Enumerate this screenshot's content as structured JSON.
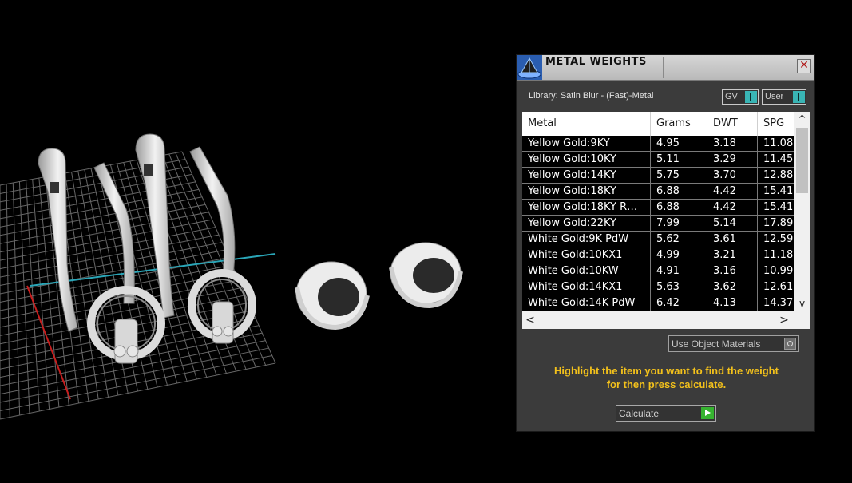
{
  "panel": {
    "title": "METAL WEIGHTS",
    "close_glyph": "✕",
    "library_label": "Library: Satin Blur - (Fast)-Metal",
    "gv_label": "GV",
    "user_label": "User",
    "columns": [
      "Metal",
      "Grams",
      "DWT",
      "SPG"
    ],
    "rows": [
      [
        "Yellow Gold:9KY",
        "4.95",
        "3.18",
        "11.08"
      ],
      [
        "Yellow Gold:10KY",
        "5.11",
        "3.29",
        "11.45"
      ],
      [
        "Yellow Gold:14KY",
        "5.75",
        "3.70",
        "12.88"
      ],
      [
        "Yellow Gold:18KY",
        "6.88",
        "4.42",
        "15.41"
      ],
      [
        "Yellow Gold:18KY R…",
        "6.88",
        "4.42",
        "15.41"
      ],
      [
        "Yellow Gold:22KY",
        "7.99",
        "5.14",
        "17.89"
      ],
      [
        "White Gold:9K PdW",
        "5.62",
        "3.61",
        "12.59"
      ],
      [
        "White Gold:10KX1",
        "4.99",
        "3.21",
        "11.18"
      ],
      [
        "White Gold:10KW",
        "4.91",
        "3.16",
        "10.99"
      ],
      [
        "White Gold:14KX1",
        "5.63",
        "3.62",
        "12.61"
      ],
      [
        "White Gold:14K PdW",
        "6.42",
        "4.13",
        "14.37"
      ]
    ],
    "scroll": {
      "up_glyph": "^",
      "down_glyph": "v",
      "left_glyph": "<",
      "right_glyph": ">"
    },
    "use_object_materials_label": "Use Object Materials",
    "hint_line1": "Highlight the item you want to find the weight",
    "hint_line2": "for then press calculate.",
    "calculate_label": "Calculate"
  },
  "colors": {
    "panel_bg": "#3b3b3b",
    "toggle_accent": "#39b5b5",
    "hint_text": "#f3c11b",
    "calculate_icon": "#36b330"
  },
  "viewport": {
    "scene": "3D render of ring and shank models on a grid"
  }
}
